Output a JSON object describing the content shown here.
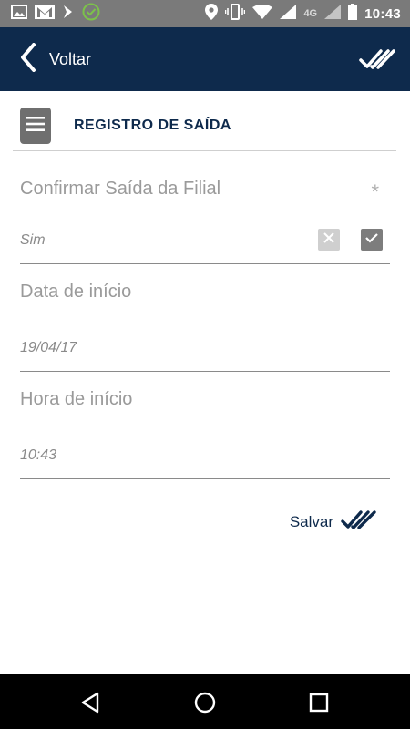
{
  "status_bar": {
    "time": "10:43",
    "network": "4G",
    "left_icons": [
      "image-icon",
      "gmail-icon",
      "chevron-right-icon",
      "check-circle-icon"
    ],
    "right_icons": [
      "location-icon",
      "vibrate-icon",
      "wifi-icon",
      "signal-icon",
      "battery-icon"
    ]
  },
  "app_bar": {
    "back_label": "Voltar",
    "confirm_icon": "double-check-icon"
  },
  "section": {
    "title": "REGISTRO DE SAÍDA",
    "menu_icon": "hamburger-icon"
  },
  "form": {
    "confirm_exit": {
      "label": "Confirmar Saída da Filial",
      "required_mark": "*",
      "value": "Sim"
    },
    "start_date": {
      "label": "Data de início",
      "value": "19/04/17"
    },
    "start_time": {
      "label": "Hora de início",
      "value": "10:43"
    }
  },
  "save": {
    "label": "Salvar",
    "icon": "double-check-icon"
  },
  "colors": {
    "primary": "#0e2a4c",
    "status_bar": "#7a7a7a",
    "label_gray": "#9a9a9a",
    "green_check": "#7cc24a"
  },
  "nav_bar": {
    "buttons": [
      "back-triangle-icon",
      "home-circle-icon",
      "recents-square-icon"
    ]
  }
}
